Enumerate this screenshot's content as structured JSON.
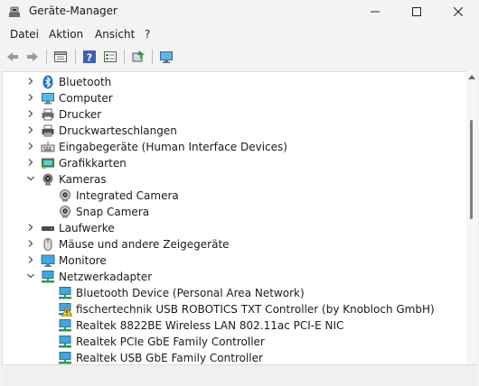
{
  "window": {
    "title": "Geräte-Manager"
  },
  "menu": [
    "Datei",
    "Aktion",
    "Ansicht",
    "?"
  ],
  "tree": [
    {
      "label": "Bluetooth",
      "icon": "bluetooth-icon",
      "expanded": false
    },
    {
      "label": "Computer",
      "icon": "computer-icon",
      "expanded": false
    },
    {
      "label": "Drucker",
      "icon": "printer-icon",
      "expanded": false
    },
    {
      "label": "Druckwarteschlangen",
      "icon": "print-queue-icon",
      "expanded": false
    },
    {
      "label": "Eingabegeräte (Human Interface Devices)",
      "icon": "hid-icon",
      "expanded": false
    },
    {
      "label": "Grafikkarten",
      "icon": "display-adapter-icon",
      "expanded": false
    },
    {
      "label": "Kameras",
      "icon": "camera-icon",
      "expanded": true,
      "children": [
        {
          "label": "Integrated Camera",
          "icon": "webcam-icon"
        },
        {
          "label": "Snap Camera",
          "icon": "webcam-icon"
        }
      ]
    },
    {
      "label": "Laufwerke",
      "icon": "drive-icon",
      "expanded": false
    },
    {
      "label": "Mäuse und andere Zeigegeräte",
      "icon": "mouse-icon",
      "expanded": false
    },
    {
      "label": "Monitore",
      "icon": "monitor-icon",
      "expanded": false
    },
    {
      "label": "Netzwerkadapter",
      "icon": "network-adapter-icon",
      "expanded": true,
      "children": [
        {
          "label": "Bluetooth Device (Personal Area Network)",
          "icon": "network-adapter-icon"
        },
        {
          "label": "fischertechnik USB ROBOTICS TXT Controller (by Knobloch GmbH)",
          "icon": "network-adapter-warning-icon",
          "warning": true
        },
        {
          "label": "Realtek 8822BE Wireless LAN 802.11ac PCI-E NIC",
          "icon": "network-adapter-icon"
        },
        {
          "label": "Realtek PCIe GbE Family Controller",
          "icon": "network-adapter-icon"
        },
        {
          "label": "Realtek USB GbE Family Controller",
          "icon": "network-adapter-icon"
        }
      ]
    }
  ]
}
